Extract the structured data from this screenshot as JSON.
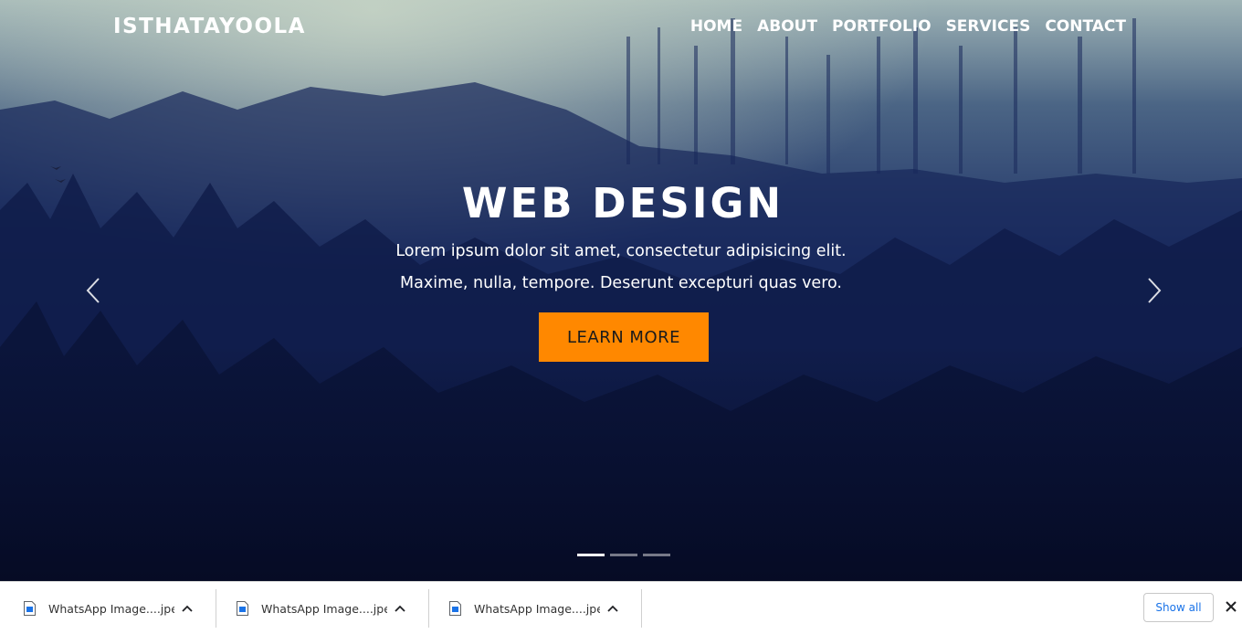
{
  "header": {
    "brand": "ISTHATAYOOLA",
    "nav": [
      "HOME",
      "ABOUT",
      "PORTFOLIO",
      "SERVICES",
      "CONTACT"
    ]
  },
  "slide": {
    "title": "WEB DESIGN",
    "line1": "Lorem ipsum dolor sit amet, consectetur adipisicing elit.",
    "line2": "Maxime, nulla, tempore. Deserunt excepturi quas vero.",
    "button": "LEARN MORE"
  },
  "carousel": {
    "slide_count": 3,
    "active_index": 0,
    "prev_icon": "chevron-left-icon",
    "next_icon": "chevron-right-icon"
  },
  "downloads": {
    "items": [
      {
        "name": "WhatsApp Image....jpeg"
      },
      {
        "name": "WhatsApp Image....jpeg"
      },
      {
        "name": "WhatsApp Image....jpeg"
      }
    ],
    "show_all": "Show all"
  },
  "colors": {
    "accent": "#ff8800",
    "link": "#1a73e8",
    "hero_dark": "#0b1540"
  }
}
